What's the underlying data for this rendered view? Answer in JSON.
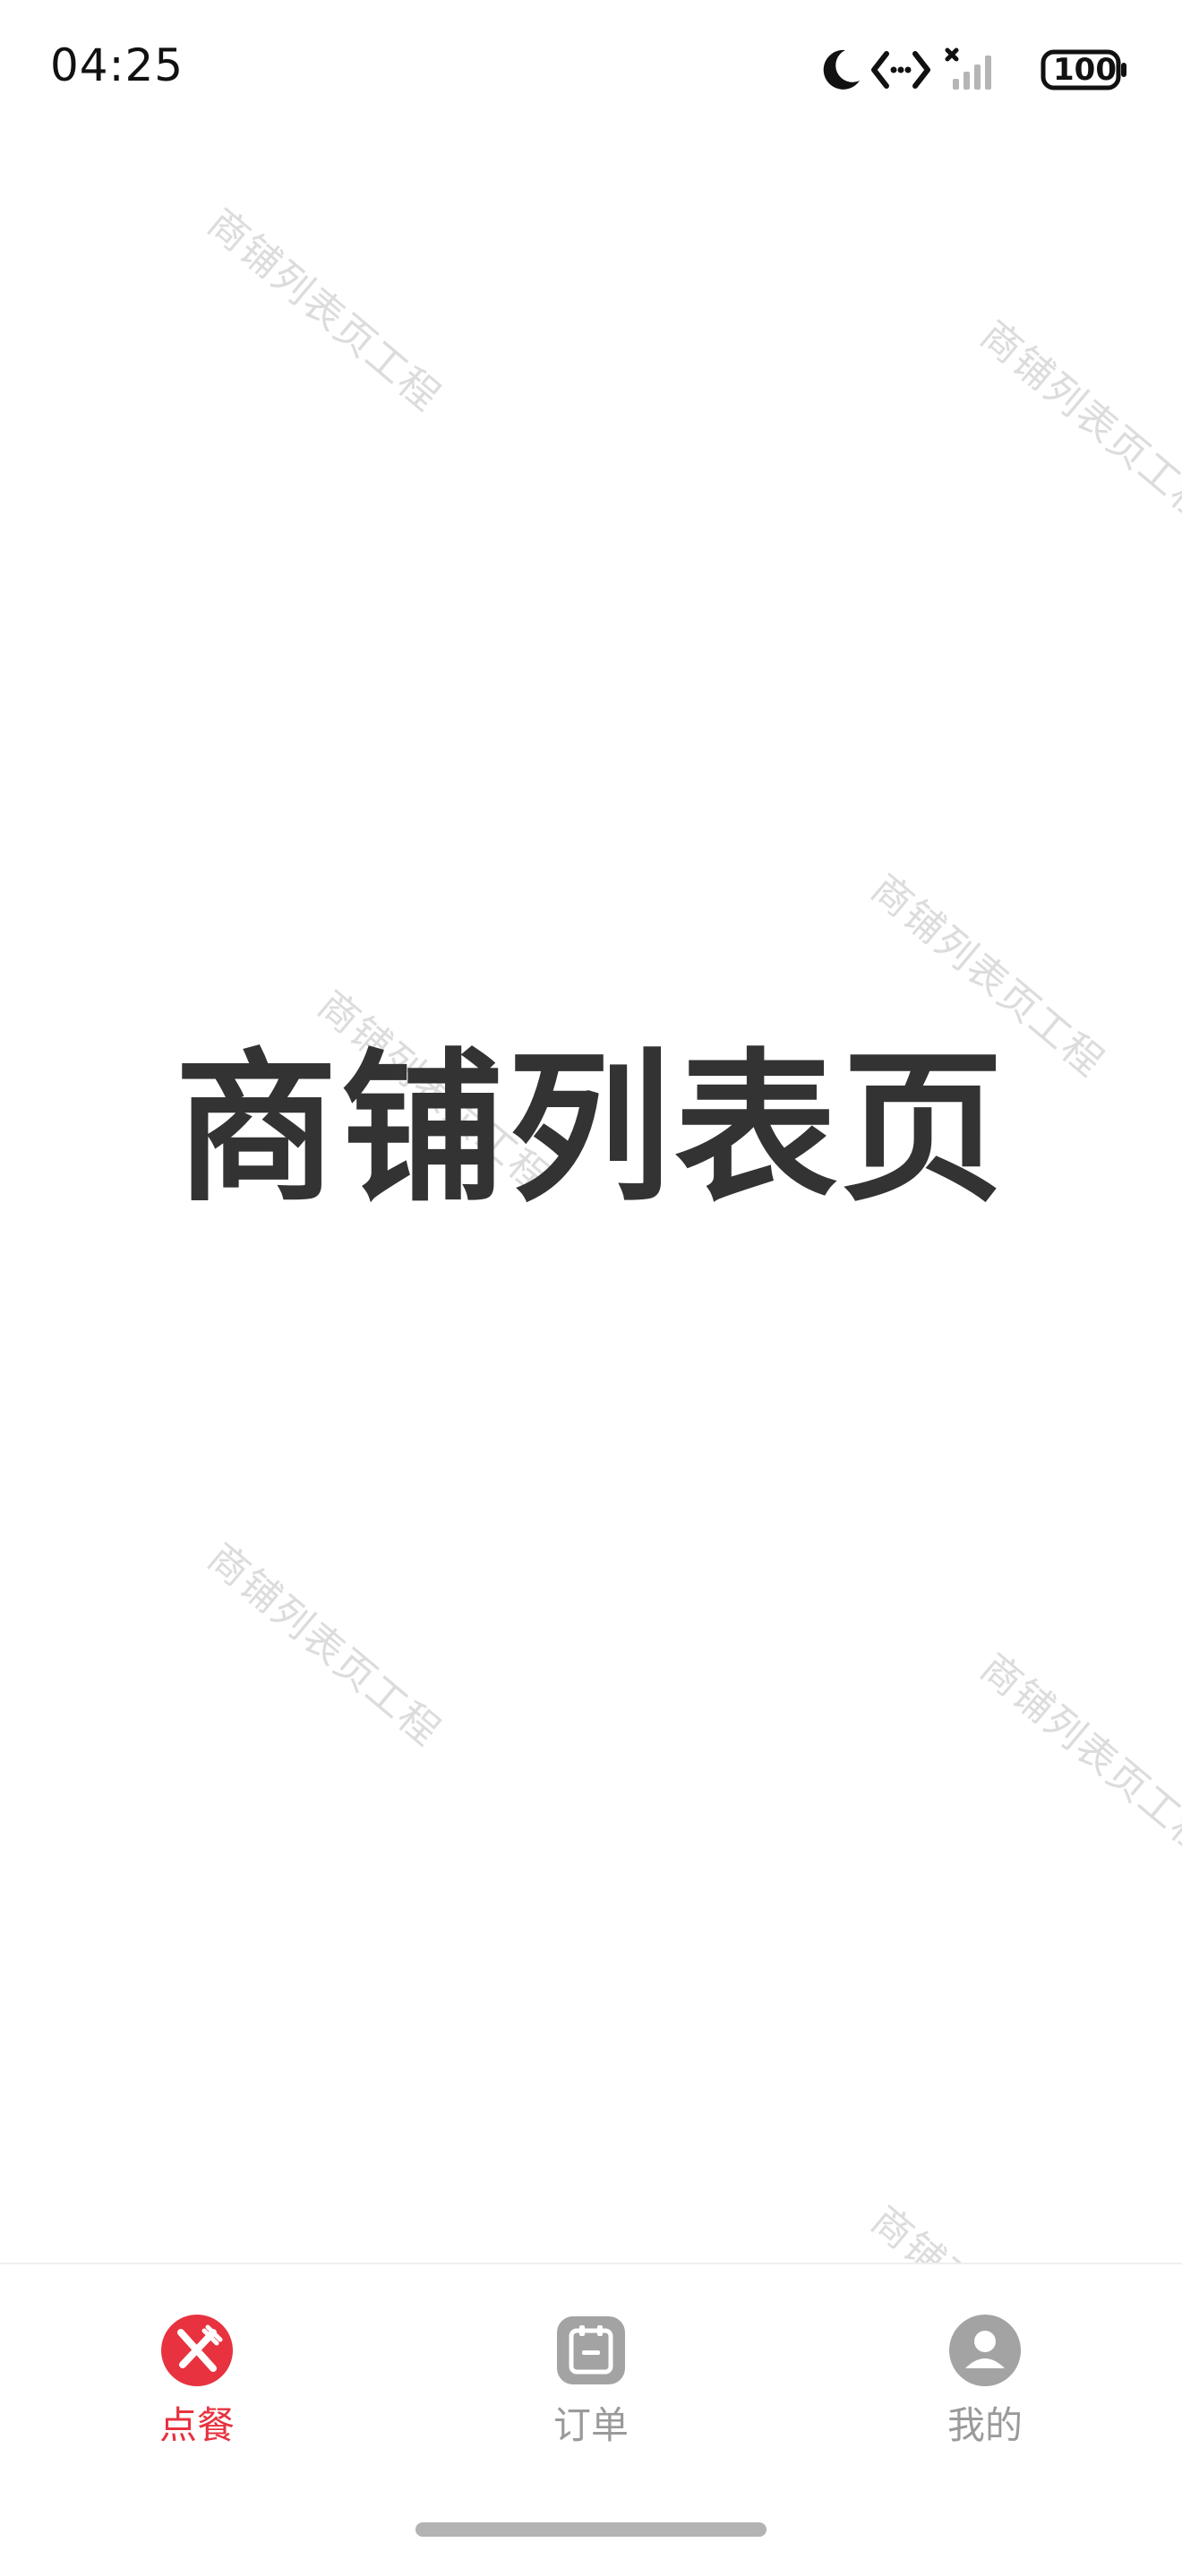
{
  "status_bar": {
    "time": "04:25",
    "battery": "100",
    "icons": [
      "moon-icon",
      "data-transfer-icon",
      "signal-icon",
      "battery-icon"
    ]
  },
  "watermark_text": "商铺列表页工程",
  "main": {
    "title": "商铺列表页"
  },
  "tab_bar": {
    "active_color": "#e8323f",
    "inactive_color": "#9a9a9a",
    "tabs": [
      {
        "label": "点餐",
        "icon": "fork-knife-icon",
        "active": true
      },
      {
        "label": "订单",
        "icon": "order-icon",
        "active": false
      },
      {
        "label": "我的",
        "icon": "user-icon",
        "active": false
      }
    ]
  }
}
